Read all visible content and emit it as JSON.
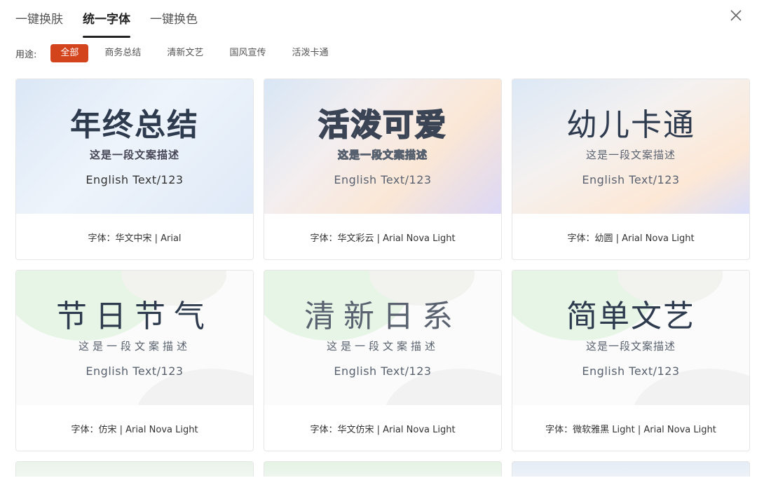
{
  "tabs": [
    {
      "label": "一键换肤",
      "active": false
    },
    {
      "label": "统一字体",
      "active": true
    },
    {
      "label": "一键换色",
      "active": false
    }
  ],
  "close_icon": "close-icon",
  "filter": {
    "label": "用途:",
    "chips": [
      "全部",
      "商务总结",
      "清新文艺",
      "国风宣传",
      "活泼卡通"
    ],
    "active": "全部"
  },
  "accent_color": "#d4441c",
  "cards": [
    {
      "title": "年终总结",
      "subtitle": "这是一段文案描述",
      "english": "English  Text/123",
      "font_info": "字体：华文中宋 | Arial"
    },
    {
      "title": "活泼可爱",
      "subtitle": "这是一段文案描述",
      "english": "English  Text/123",
      "font_info": "字体：华文彩云 | Arial Nova Light"
    },
    {
      "title": "幼儿卡通",
      "subtitle": "这是一段文案描述",
      "english": "English  Text/123",
      "font_info": "字体：幼圆 | Arial Nova Light"
    },
    {
      "title": "节日节气",
      "subtitle": "这是一段文案描述",
      "english": "English  Text/123",
      "font_info": "字体：仿宋 | Arial Nova Light"
    },
    {
      "title": "清新日系",
      "subtitle": "这是一段文案描述",
      "english": "English  Text/123",
      "font_info": "字体：华文仿宋 | Arial Nova Light"
    },
    {
      "title": "简单文艺",
      "subtitle": "这是一段文案描述",
      "english": "English  Text/123",
      "font_info": "字体：微软雅黑 Light | Arial Nova Light"
    }
  ]
}
